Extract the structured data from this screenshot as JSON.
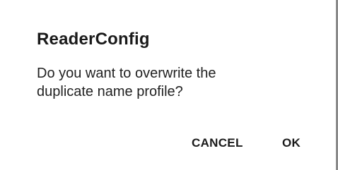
{
  "dialog": {
    "title": "ReaderConfig",
    "message_lines": [
      "Do you want to overwrite the",
      "duplicate name profile?"
    ],
    "buttons": {
      "cancel_label": "CANCEL",
      "ok_label": "OK"
    }
  },
  "colors": {
    "background": "#ffffff",
    "text": "#1a1a1a",
    "edge": "#8a8a8a"
  }
}
